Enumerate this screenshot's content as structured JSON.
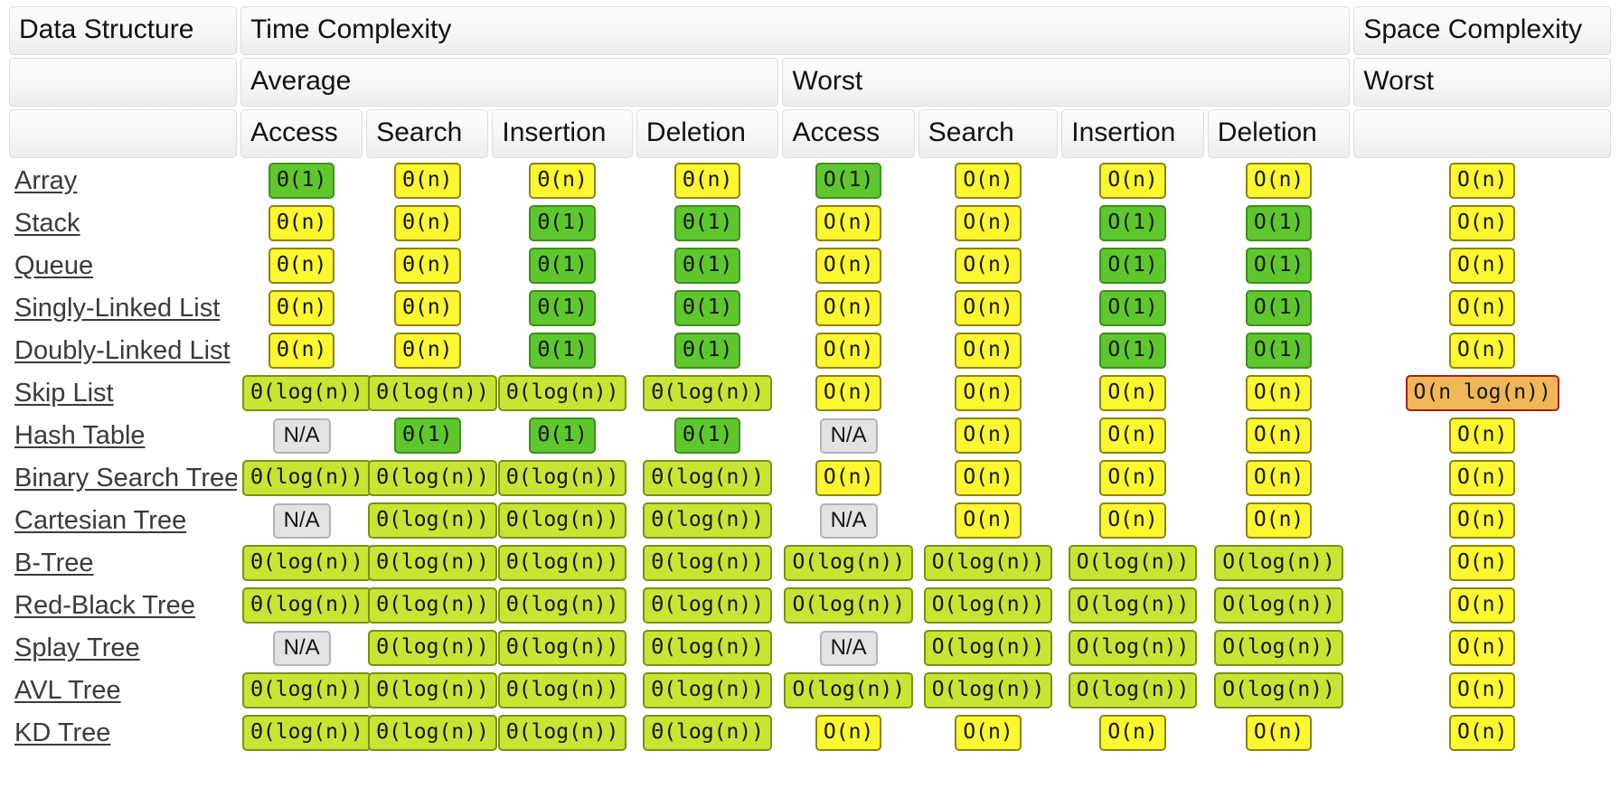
{
  "header": {
    "row1": [
      {
        "label": "Data Structure",
        "span": 1
      },
      {
        "label": "Time Complexity",
        "span": 8
      },
      {
        "label": "Space Complexity",
        "span": 1
      }
    ],
    "row2": [
      {
        "label": "",
        "span": 1
      },
      {
        "label": "Average",
        "span": 4
      },
      {
        "label": "Worst",
        "span": 4
      },
      {
        "label": "Worst",
        "span": 1
      }
    ],
    "row3": [
      {
        "label": "",
        "span": 1
      },
      {
        "label": "Access",
        "span": 1
      },
      {
        "label": "Search",
        "span": 1
      },
      {
        "label": "Insertion",
        "span": 1
      },
      {
        "label": "Deletion",
        "span": 1
      },
      {
        "label": "Access",
        "span": 1
      },
      {
        "label": "Search",
        "span": 1
      },
      {
        "label": "Insertion",
        "span": 1
      },
      {
        "label": "Deletion",
        "span": 1
      },
      {
        "label": "",
        "span": 1
      }
    ]
  },
  "colors": {
    "green": "#5fc72e",
    "lime": "#c7e532",
    "yellow": "#fcf72e",
    "orange": "#f1b757",
    "na": "#e3e3e3",
    "header_bg": "#f6f6f6",
    "link": "#3a3a3a"
  },
  "rows": [
    {
      "name": "Array",
      "cells": [
        {
          "text": "Θ(1)",
          "color": "green"
        },
        {
          "text": "Θ(n)",
          "color": "yellow"
        },
        {
          "text": "Θ(n)",
          "color": "yellow"
        },
        {
          "text": "Θ(n)",
          "color": "yellow"
        },
        {
          "text": "O(1)",
          "color": "green"
        },
        {
          "text": "O(n)",
          "color": "yellow"
        },
        {
          "text": "O(n)",
          "color": "yellow"
        },
        {
          "text": "O(n)",
          "color": "yellow"
        },
        {
          "text": "O(n)",
          "color": "yellow"
        }
      ]
    },
    {
      "name": "Stack",
      "cells": [
        {
          "text": "Θ(n)",
          "color": "yellow"
        },
        {
          "text": "Θ(n)",
          "color": "yellow"
        },
        {
          "text": "Θ(1)",
          "color": "green"
        },
        {
          "text": "Θ(1)",
          "color": "green"
        },
        {
          "text": "O(n)",
          "color": "yellow"
        },
        {
          "text": "O(n)",
          "color": "yellow"
        },
        {
          "text": "O(1)",
          "color": "green"
        },
        {
          "text": "O(1)",
          "color": "green"
        },
        {
          "text": "O(n)",
          "color": "yellow"
        }
      ]
    },
    {
      "name": "Queue",
      "cells": [
        {
          "text": "Θ(n)",
          "color": "yellow"
        },
        {
          "text": "Θ(n)",
          "color": "yellow"
        },
        {
          "text": "Θ(1)",
          "color": "green"
        },
        {
          "text": "Θ(1)",
          "color": "green"
        },
        {
          "text": "O(n)",
          "color": "yellow"
        },
        {
          "text": "O(n)",
          "color": "yellow"
        },
        {
          "text": "O(1)",
          "color": "green"
        },
        {
          "text": "O(1)",
          "color": "green"
        },
        {
          "text": "O(n)",
          "color": "yellow"
        }
      ]
    },
    {
      "name": "Singly-Linked List",
      "cells": [
        {
          "text": "Θ(n)",
          "color": "yellow"
        },
        {
          "text": "Θ(n)",
          "color": "yellow"
        },
        {
          "text": "Θ(1)",
          "color": "green"
        },
        {
          "text": "Θ(1)",
          "color": "green"
        },
        {
          "text": "O(n)",
          "color": "yellow"
        },
        {
          "text": "O(n)",
          "color": "yellow"
        },
        {
          "text": "O(1)",
          "color": "green"
        },
        {
          "text": "O(1)",
          "color": "green"
        },
        {
          "text": "O(n)",
          "color": "yellow"
        }
      ]
    },
    {
      "name": "Doubly-Linked List",
      "cells": [
        {
          "text": "Θ(n)",
          "color": "yellow"
        },
        {
          "text": "Θ(n)",
          "color": "yellow"
        },
        {
          "text": "Θ(1)",
          "color": "green"
        },
        {
          "text": "Θ(1)",
          "color": "green"
        },
        {
          "text": "O(n)",
          "color": "yellow"
        },
        {
          "text": "O(n)",
          "color": "yellow"
        },
        {
          "text": "O(1)",
          "color": "green"
        },
        {
          "text": "O(1)",
          "color": "green"
        },
        {
          "text": "O(n)",
          "color": "yellow"
        }
      ]
    },
    {
      "name": "Skip List",
      "cells": [
        {
          "text": "Θ(log(n))",
          "color": "lime"
        },
        {
          "text": "Θ(log(n))",
          "color": "lime"
        },
        {
          "text": "Θ(log(n))",
          "color": "lime"
        },
        {
          "text": "Θ(log(n))",
          "color": "lime"
        },
        {
          "text": "O(n)",
          "color": "yellow"
        },
        {
          "text": "O(n)",
          "color": "yellow"
        },
        {
          "text": "O(n)",
          "color": "yellow"
        },
        {
          "text": "O(n)",
          "color": "yellow"
        },
        {
          "text": "O(n log(n))",
          "color": "orange"
        }
      ]
    },
    {
      "name": "Hash Table",
      "cells": [
        {
          "text": "N/A",
          "color": "na"
        },
        {
          "text": "Θ(1)",
          "color": "green"
        },
        {
          "text": "Θ(1)",
          "color": "green"
        },
        {
          "text": "Θ(1)",
          "color": "green"
        },
        {
          "text": "N/A",
          "color": "na"
        },
        {
          "text": "O(n)",
          "color": "yellow"
        },
        {
          "text": "O(n)",
          "color": "yellow"
        },
        {
          "text": "O(n)",
          "color": "yellow"
        },
        {
          "text": "O(n)",
          "color": "yellow"
        }
      ]
    },
    {
      "name": "Binary Search Tree",
      "cells": [
        {
          "text": "Θ(log(n))",
          "color": "lime"
        },
        {
          "text": "Θ(log(n))",
          "color": "lime"
        },
        {
          "text": "Θ(log(n))",
          "color": "lime"
        },
        {
          "text": "Θ(log(n))",
          "color": "lime"
        },
        {
          "text": "O(n)",
          "color": "yellow"
        },
        {
          "text": "O(n)",
          "color": "yellow"
        },
        {
          "text": "O(n)",
          "color": "yellow"
        },
        {
          "text": "O(n)",
          "color": "yellow"
        },
        {
          "text": "O(n)",
          "color": "yellow"
        }
      ]
    },
    {
      "name": "Cartesian Tree",
      "cells": [
        {
          "text": "N/A",
          "color": "na"
        },
        {
          "text": "Θ(log(n))",
          "color": "lime"
        },
        {
          "text": "Θ(log(n))",
          "color": "lime"
        },
        {
          "text": "Θ(log(n))",
          "color": "lime"
        },
        {
          "text": "N/A",
          "color": "na"
        },
        {
          "text": "O(n)",
          "color": "yellow"
        },
        {
          "text": "O(n)",
          "color": "yellow"
        },
        {
          "text": "O(n)",
          "color": "yellow"
        },
        {
          "text": "O(n)",
          "color": "yellow"
        }
      ]
    },
    {
      "name": "B-Tree",
      "cells": [
        {
          "text": "Θ(log(n))",
          "color": "lime"
        },
        {
          "text": "Θ(log(n))",
          "color": "lime"
        },
        {
          "text": "Θ(log(n))",
          "color": "lime"
        },
        {
          "text": "Θ(log(n))",
          "color": "lime"
        },
        {
          "text": "O(log(n))",
          "color": "lime"
        },
        {
          "text": "O(log(n))",
          "color": "lime"
        },
        {
          "text": "O(log(n))",
          "color": "lime"
        },
        {
          "text": "O(log(n))",
          "color": "lime"
        },
        {
          "text": "O(n)",
          "color": "yellow"
        }
      ]
    },
    {
      "name": "Red-Black Tree",
      "cells": [
        {
          "text": "Θ(log(n))",
          "color": "lime"
        },
        {
          "text": "Θ(log(n))",
          "color": "lime"
        },
        {
          "text": "Θ(log(n))",
          "color": "lime"
        },
        {
          "text": "Θ(log(n))",
          "color": "lime"
        },
        {
          "text": "O(log(n))",
          "color": "lime"
        },
        {
          "text": "O(log(n))",
          "color": "lime"
        },
        {
          "text": "O(log(n))",
          "color": "lime"
        },
        {
          "text": "O(log(n))",
          "color": "lime"
        },
        {
          "text": "O(n)",
          "color": "yellow"
        }
      ]
    },
    {
      "name": "Splay Tree",
      "cells": [
        {
          "text": "N/A",
          "color": "na"
        },
        {
          "text": "Θ(log(n))",
          "color": "lime"
        },
        {
          "text": "Θ(log(n))",
          "color": "lime"
        },
        {
          "text": "Θ(log(n))",
          "color": "lime"
        },
        {
          "text": "N/A",
          "color": "na"
        },
        {
          "text": "O(log(n))",
          "color": "lime"
        },
        {
          "text": "O(log(n))",
          "color": "lime"
        },
        {
          "text": "O(log(n))",
          "color": "lime"
        },
        {
          "text": "O(n)",
          "color": "yellow"
        }
      ]
    },
    {
      "name": "AVL Tree",
      "cells": [
        {
          "text": "Θ(log(n))",
          "color": "lime"
        },
        {
          "text": "Θ(log(n))",
          "color": "lime"
        },
        {
          "text": "Θ(log(n))",
          "color": "lime"
        },
        {
          "text": "Θ(log(n))",
          "color": "lime"
        },
        {
          "text": "O(log(n))",
          "color": "lime"
        },
        {
          "text": "O(log(n))",
          "color": "lime"
        },
        {
          "text": "O(log(n))",
          "color": "lime"
        },
        {
          "text": "O(log(n))",
          "color": "lime"
        },
        {
          "text": "O(n)",
          "color": "yellow"
        }
      ]
    },
    {
      "name": "KD Tree",
      "cells": [
        {
          "text": "Θ(log(n))",
          "color": "lime"
        },
        {
          "text": "Θ(log(n))",
          "color": "lime"
        },
        {
          "text": "Θ(log(n))",
          "color": "lime"
        },
        {
          "text": "Θ(log(n))",
          "color": "lime"
        },
        {
          "text": "O(n)",
          "color": "yellow"
        },
        {
          "text": "O(n)",
          "color": "yellow"
        },
        {
          "text": "O(n)",
          "color": "yellow"
        },
        {
          "text": "O(n)",
          "color": "yellow"
        },
        {
          "text": "O(n)",
          "color": "yellow"
        }
      ]
    }
  ]
}
